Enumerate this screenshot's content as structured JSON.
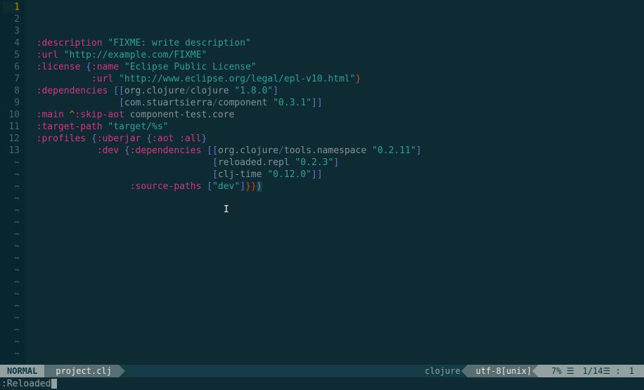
{
  "gutter": {
    "start": 1,
    "end": 13,
    "current": 1,
    "tildeCount": 17
  },
  "code": {
    "lines": [
      [
        {
          "t": "  ",
          "c": "ident"
        },
        {
          "t": ":description",
          "c": "keyword"
        },
        {
          "t": " ",
          "c": "ident"
        },
        {
          "t": "\"FIXME: write description\"",
          "c": "string"
        }
      ],
      [
        {
          "t": "  ",
          "c": "ident"
        },
        {
          "t": ":url",
          "c": "keyword"
        },
        {
          "t": " ",
          "c": "ident"
        },
        {
          "t": "\"http://example.com/FIXME\"",
          "c": "string"
        }
      ],
      [
        {
          "t": "  ",
          "c": "ident"
        },
        {
          "t": ":license",
          "c": "keyword"
        },
        {
          "t": " ",
          "c": "ident"
        },
        {
          "t": "{",
          "c": "bracket"
        },
        {
          "t": ":name",
          "c": "keyword"
        },
        {
          "t": " ",
          "c": "ident"
        },
        {
          "t": "\"Eclipse Public License\"",
          "c": "string"
        }
      ],
      [
        {
          "t": "            ",
          "c": "ident"
        },
        {
          "t": ":url",
          "c": "keyword"
        },
        {
          "t": " ",
          "c": "ident"
        },
        {
          "t": "\"http://www.eclipse.org/legal/epl-v10.html\"",
          "c": "string"
        },
        {
          "t": "}",
          "c": "bracket2"
        }
      ],
      [
        {
          "t": "  ",
          "c": "ident"
        },
        {
          "t": ":dependencies",
          "c": "keyword"
        },
        {
          "t": " ",
          "c": "ident"
        },
        {
          "t": "[[",
          "c": "bracket"
        },
        {
          "t": "org.clojure",
          "c": "ident"
        },
        {
          "t": "/",
          "c": "dim"
        },
        {
          "t": "clojure",
          "c": "ident"
        },
        {
          "t": " ",
          "c": "ident"
        },
        {
          "t": "\"1.8.0\"",
          "c": "string"
        },
        {
          "t": "]",
          "c": "bracket"
        }
      ],
      [
        {
          "t": "                 ",
          "c": "ident"
        },
        {
          "t": "[",
          "c": "bracket"
        },
        {
          "t": "com.stuartsierra",
          "c": "ident"
        },
        {
          "t": "/",
          "c": "dim"
        },
        {
          "t": "component",
          "c": "ident"
        },
        {
          "t": " ",
          "c": "ident"
        },
        {
          "t": "\"0.3.1\"",
          "c": "string"
        },
        {
          "t": "]]",
          "c": "bracket"
        }
      ],
      [
        {
          "t": "  ",
          "c": "ident"
        },
        {
          "t": ":main",
          "c": "keyword"
        },
        {
          "t": " ",
          "c": "ident"
        },
        {
          "t": "^",
          "c": "symbol"
        },
        {
          "t": ":skip-aot",
          "c": "keyword"
        },
        {
          "t": " component-test.core",
          "c": "ident"
        }
      ],
      [
        {
          "t": "  ",
          "c": "ident"
        },
        {
          "t": ":target-path",
          "c": "keyword"
        },
        {
          "t": " ",
          "c": "ident"
        },
        {
          "t": "\"target/%s\"",
          "c": "string"
        }
      ],
      [
        {
          "t": "  ",
          "c": "ident"
        },
        {
          "t": ":profiles",
          "c": "keyword"
        },
        {
          "t": " ",
          "c": "ident"
        },
        {
          "t": "{",
          "c": "bracket"
        },
        {
          "t": ":uberjar",
          "c": "keyword"
        },
        {
          "t": " ",
          "c": "ident"
        },
        {
          "t": "{",
          "c": "bracket"
        },
        {
          "t": ":aot",
          "c": "keyword"
        },
        {
          "t": " ",
          "c": "ident"
        },
        {
          "t": ":all",
          "c": "keyword"
        },
        {
          "t": "}",
          "c": "bracket"
        }
      ],
      [
        {
          "t": "             ",
          "c": "ident"
        },
        {
          "t": ":dev",
          "c": "keyword"
        },
        {
          "t": " ",
          "c": "ident"
        },
        {
          "t": "{",
          "c": "bracket"
        },
        {
          "t": ":dependencies",
          "c": "keyword"
        },
        {
          "t": " ",
          "c": "ident"
        },
        {
          "t": "[[",
          "c": "bracket"
        },
        {
          "t": "org.clojure",
          "c": "ident"
        },
        {
          "t": "/",
          "c": "dim"
        },
        {
          "t": "tools.namespace",
          "c": "ident"
        },
        {
          "t": " ",
          "c": "ident"
        },
        {
          "t": "\"0.2.11\"",
          "c": "string"
        },
        {
          "t": "]",
          "c": "bracket"
        }
      ],
      [
        {
          "t": "                                  ",
          "c": "ident"
        },
        {
          "t": "[",
          "c": "bracket"
        },
        {
          "t": "reloaded.repl",
          "c": "ident"
        },
        {
          "t": " ",
          "c": "ident"
        },
        {
          "t": "\"0.2.3\"",
          "c": "string"
        },
        {
          "t": "]",
          "c": "bracket"
        }
      ],
      [
        {
          "t": "                                  ",
          "c": "ident"
        },
        {
          "t": "[",
          "c": "bracket"
        },
        {
          "t": "clj-time",
          "c": "ident"
        },
        {
          "t": " ",
          "c": "ident"
        },
        {
          "t": "\"0.12.0\"",
          "c": "string"
        },
        {
          "t": "]]",
          "c": "bracket"
        }
      ],
      [
        {
          "t": "                   ",
          "c": "ident"
        },
        {
          "t": ":source-paths",
          "c": "keyword"
        },
        {
          "t": " ",
          "c": "ident"
        },
        {
          "t": "[",
          "c": "bracket"
        },
        {
          "t": "\"dev\"",
          "c": "string"
        },
        {
          "t": "]",
          "c": "bracket"
        },
        {
          "t": "}}",
          "c": "bracket2"
        },
        {
          "t": ")",
          "c": "highlight-paren"
        }
      ]
    ]
  },
  "status": {
    "mode": "NORMAL",
    "filename": "project.clj",
    "filetype": "clojure",
    "encoding": "utf-8[unix]",
    "percent": "7% ☰",
    "lineinfo": "1/14☰ :",
    "col": "1"
  },
  "command": {
    "text": ":Reloaded"
  }
}
